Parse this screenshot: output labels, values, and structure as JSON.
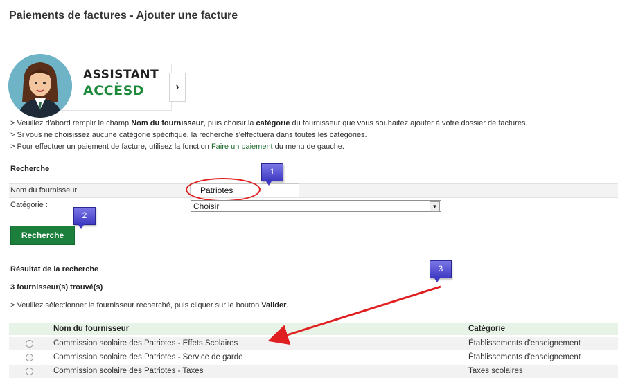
{
  "page": {
    "title": "Paiements de factures - Ajouter une facture"
  },
  "assistant": {
    "line1": "ASSISTANT",
    "line2": "ACCÈSD",
    "next_glyph": "›"
  },
  "instructions": {
    "line1_a": "> Veuillez d'abord remplir le champ ",
    "line1_b": "Nom du fournisseur",
    "line1_c": ", puis choisir la ",
    "line1_d": "catégorie",
    "line1_e": " du fournisseur que vous souhaitez ajouter à votre dossier de factures.",
    "line2": "> Si vous ne choisissez aucune catégorie spécifique, la recherche s'effectuera dans toutes les catégories.",
    "line3_a": "> Pour effectuer un paiement de facture, utilisez la fonction ",
    "line3_link": "Faire un paiement",
    "line3_b": " du menu de gauche."
  },
  "search": {
    "heading": "Recherche",
    "supplier_label": "Nom du fournisseur :",
    "supplier_value": "Patriotes",
    "category_label": "Catégorie :",
    "category_value": "Choisir",
    "button_label": "Recherche"
  },
  "results": {
    "heading": "Résultat de la recherche",
    "count": "3 fournisseur(s) trouvé(s)",
    "instr_a": "> Veuillez sélectionner le fournisseur recherché, puis cliquer sur le bouton ",
    "instr_b": "Valider",
    "instr_c": ".",
    "columns": [
      "Nom du fournisseur",
      "Catégorie"
    ],
    "rows": [
      {
        "name": "Commission scolaire des Patriotes - Effets Scolaires",
        "category": "Établissements d'enseignement"
      },
      {
        "name": "Commission scolaire des Patriotes - Service de garde",
        "category": "Établissements d'enseignement"
      },
      {
        "name": "Commission scolaire des Patriotes - Taxes",
        "category": "Taxes scolaires"
      }
    ]
  },
  "callouts": [
    "1",
    "2",
    "3"
  ],
  "colors": {
    "accent_green": "#1d7f3c",
    "annotation_red": "#e02020",
    "callout_blue": "#4b46cf"
  }
}
